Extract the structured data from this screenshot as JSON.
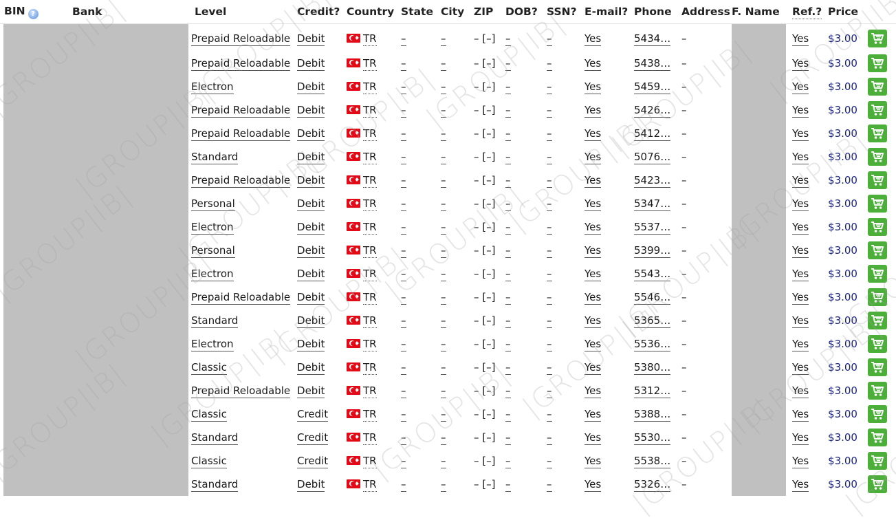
{
  "header": {
    "bin": "BIN",
    "bank": "Bank",
    "level": "Level",
    "credit": "Credit?",
    "country": "Country",
    "state": "State",
    "city": "City",
    "zip": "ZIP",
    "dob": "DOB?",
    "ssn": "SSN?",
    "email": "E-mail?",
    "phone": "Phone",
    "address": "Address",
    "fname": "F. Name",
    "ref": "Ref.?",
    "price": "Price"
  },
  "icons": {
    "info": "info-icon",
    "cart": "add-to-cart-icon",
    "flag": "turkey-flag-icon"
  },
  "colors": {
    "cart": "#4caf3a",
    "price": "#1a237e",
    "redacted": "#c0c0c0"
  },
  "watermark": "|GROUP|IB|",
  "rows": [
    {
      "level": "Prepaid Reloadable",
      "credit": "Debit",
      "country": "TR",
      "state": "–",
      "city": "–",
      "zip": "– [–]",
      "dob": "–",
      "ssn": "–",
      "email": "Yes",
      "phone": "5434…",
      "address": "–",
      "ref": "Yes",
      "price": "$3.00"
    },
    {
      "level": "Prepaid Reloadable",
      "credit": "Debit",
      "country": "TR",
      "state": "–",
      "city": "–",
      "zip": "– [–]",
      "dob": "–",
      "ssn": "–",
      "email": "Yes",
      "phone": "5438…",
      "address": "–",
      "ref": "Yes",
      "price": "$3.00"
    },
    {
      "level": "Electron",
      "credit": "Debit",
      "country": "TR",
      "state": "–",
      "city": "–",
      "zip": "– [–]",
      "dob": "–",
      "ssn": "–",
      "email": "Yes",
      "phone": "5459…",
      "address": "–",
      "ref": "Yes",
      "price": "$3.00"
    },
    {
      "level": "Prepaid Reloadable",
      "credit": "Debit",
      "country": "TR",
      "state": "–",
      "city": "–",
      "zip": "– [–]",
      "dob": "–",
      "ssn": "–",
      "email": "Yes",
      "phone": "5426…",
      "address": "–",
      "ref": "Yes",
      "price": "$3.00"
    },
    {
      "level": "Prepaid Reloadable",
      "credit": "Debit",
      "country": "TR",
      "state": "–",
      "city": "–",
      "zip": "– [–]",
      "dob": "–",
      "ssn": "–",
      "email": "Yes",
      "phone": "5412…",
      "address": "–",
      "ref": "Yes",
      "price": "$3.00"
    },
    {
      "level": "Standard",
      "credit": "Debit",
      "country": "TR",
      "state": "–",
      "city": "–",
      "zip": "– [–]",
      "dob": "–",
      "ssn": "–",
      "email": "Yes",
      "phone": "5076…",
      "address": "–",
      "ref": "Yes",
      "price": "$3.00"
    },
    {
      "level": "Prepaid Reloadable",
      "credit": "Debit",
      "country": "TR",
      "state": "–",
      "city": "–",
      "zip": "– [–]",
      "dob": "–",
      "ssn": "–",
      "email": "Yes",
      "phone": "5423…",
      "address": "–",
      "ref": "Yes",
      "price": "$3.00"
    },
    {
      "level": "Personal",
      "credit": "Debit",
      "country": "TR",
      "state": "–",
      "city": "–",
      "zip": "– [–]",
      "dob": "–",
      "ssn": "–",
      "email": "Yes",
      "phone": "5347…",
      "address": "–",
      "ref": "Yes",
      "price": "$3.00"
    },
    {
      "level": "Electron",
      "credit": "Debit",
      "country": "TR",
      "state": "–",
      "city": "–",
      "zip": "– [–]",
      "dob": "–",
      "ssn": "–",
      "email": "Yes",
      "phone": "5537…",
      "address": "–",
      "ref": "Yes",
      "price": "$3.00"
    },
    {
      "level": "Personal",
      "credit": "Debit",
      "country": "TR",
      "state": "–",
      "city": "–",
      "zip": "– [–]",
      "dob": "–",
      "ssn": "–",
      "email": "Yes",
      "phone": "5399…",
      "address": "–",
      "ref": "Yes",
      "price": "$3.00"
    },
    {
      "level": "Electron",
      "credit": "Debit",
      "country": "TR",
      "state": "–",
      "city": "–",
      "zip": "– [–]",
      "dob": "–",
      "ssn": "–",
      "email": "Yes",
      "phone": "5543…",
      "address": "–",
      "ref": "Yes",
      "price": "$3.00"
    },
    {
      "level": "Prepaid Reloadable",
      "credit": "Debit",
      "country": "TR",
      "state": "–",
      "city": "–",
      "zip": "– [–]",
      "dob": "–",
      "ssn": "–",
      "email": "Yes",
      "phone": "5546…",
      "address": "–",
      "ref": "Yes",
      "price": "$3.00"
    },
    {
      "level": "Standard",
      "credit": "Debit",
      "country": "TR",
      "state": "–",
      "city": "–",
      "zip": "– [–]",
      "dob": "–",
      "ssn": "–",
      "email": "Yes",
      "phone": "5365…",
      "address": "–",
      "ref": "Yes",
      "price": "$3.00"
    },
    {
      "level": "Electron",
      "credit": "Debit",
      "country": "TR",
      "state": "–",
      "city": "–",
      "zip": "– [–]",
      "dob": "–",
      "ssn": "–",
      "email": "Yes",
      "phone": "5536…",
      "address": "–",
      "ref": "Yes",
      "price": "$3.00"
    },
    {
      "level": "Classic",
      "credit": "Debit",
      "country": "TR",
      "state": "–",
      "city": "–",
      "zip": "– [–]",
      "dob": "–",
      "ssn": "–",
      "email": "Yes",
      "phone": "5380…",
      "address": "–",
      "ref": "Yes",
      "price": "$3.00"
    },
    {
      "level": "Prepaid Reloadable",
      "credit": "Debit",
      "country": "TR",
      "state": "–",
      "city": "–",
      "zip": "– [–]",
      "dob": "–",
      "ssn": "–",
      "email": "Yes",
      "phone": "5312…",
      "address": "–",
      "ref": "Yes",
      "price": "$3.00"
    },
    {
      "level": "Classic",
      "credit": "Credit",
      "country": "TR",
      "state": "–",
      "city": "–",
      "zip": "– [–]",
      "dob": "–",
      "ssn": "–",
      "email": "Yes",
      "phone": "5388…",
      "address": "–",
      "ref": "Yes",
      "price": "$3.00"
    },
    {
      "level": "Standard",
      "credit": "Credit",
      "country": "TR",
      "state": "–",
      "city": "–",
      "zip": "– [–]",
      "dob": "–",
      "ssn": "–",
      "email": "Yes",
      "phone": "5530…",
      "address": "–",
      "ref": "Yes",
      "price": "$3.00"
    },
    {
      "level": "Classic",
      "credit": "Credit",
      "country": "TR",
      "state": "–",
      "city": "–",
      "zip": "– [–]",
      "dob": "–",
      "ssn": "–",
      "email": "Yes",
      "phone": "5538…",
      "address": "–",
      "ref": "Yes",
      "price": "$3.00"
    },
    {
      "level": "Standard",
      "credit": "Debit",
      "country": "TR",
      "state": "–",
      "city": "–",
      "zip": "– [–]",
      "dob": "–",
      "ssn": "–",
      "email": "Yes",
      "phone": "5326…",
      "address": "–",
      "ref": "Yes",
      "price": "$3.00"
    }
  ]
}
